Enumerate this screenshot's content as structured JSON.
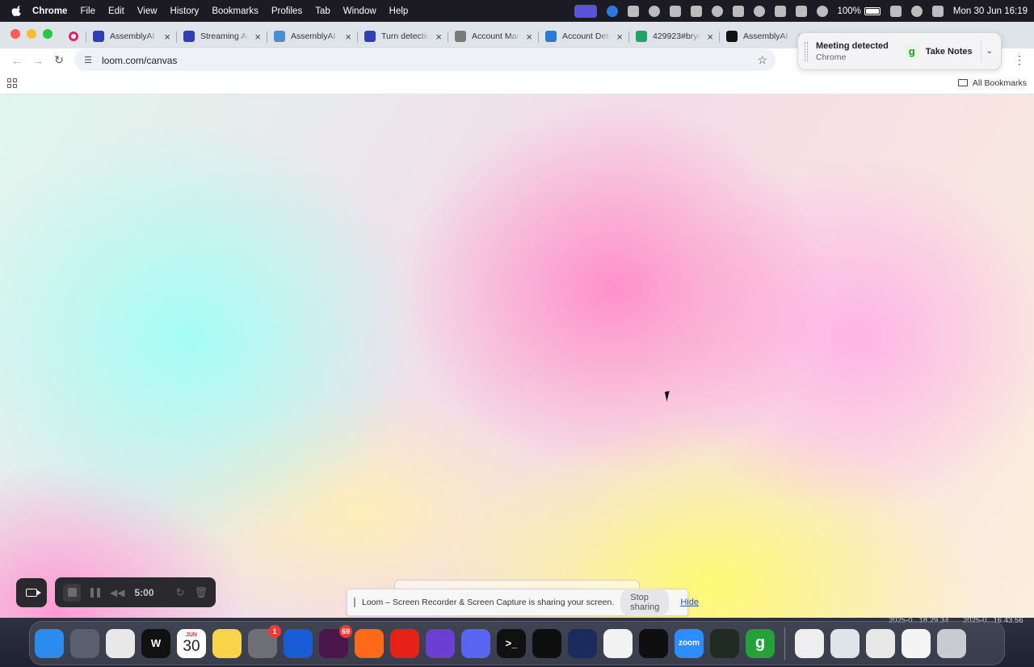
{
  "menubar": {
    "app_name": "Chrome",
    "items": [
      "File",
      "Edit",
      "View",
      "History",
      "Bookmarks",
      "Profiles",
      "Tab",
      "Window",
      "Help"
    ],
    "battery": "100%",
    "battery_level": 1.0,
    "datetime": "Mon 30 Jun  16:19"
  },
  "tabs": [
    {
      "title": "",
      "icon": "recording-icon",
      "color": "#e0245e"
    },
    {
      "title": "AssemblyAI |",
      "icon": "assemblyai-icon",
      "color": "#2f3fb6"
    },
    {
      "title": "Streaming Au",
      "icon": "assemblyai-icon",
      "color": "#2f3fb6"
    },
    {
      "title": "AssemblyAI -",
      "icon": "docs-icon",
      "color": "#4a8fd6"
    },
    {
      "title": "Turn detectio",
      "icon": "assemblyai-icon",
      "color": "#2f3fb6"
    },
    {
      "title": "Account Mana",
      "icon": "account-icon",
      "color": "#7a7a7a"
    },
    {
      "title": "Account Deta",
      "icon": "account-icon",
      "color": "#2a7bd8"
    },
    {
      "title": "429923#brya",
      "icon": "sheet-icon",
      "color": "#21a366"
    },
    {
      "title": "AssemblyAI",
      "icon": "github-icon",
      "color": "#111111"
    }
  ],
  "toolbar": {
    "url": "loom.com/canvas"
  },
  "bookmarks": {
    "all_label": "All Bookmarks"
  },
  "meeting_popup": {
    "title": "Meeting detected",
    "subtitle": "Chrome",
    "button_label": "Take Notes",
    "logo_letter": "g"
  },
  "loom": {
    "timer": "5:00"
  },
  "sharing": {
    "message": "Loom – Screen Recorder & Screen Capture is sharing your screen.",
    "stop_label": "Stop sharing",
    "hide_label": "Hide"
  },
  "desktop_labels": [
    "2025-0...18.29.34",
    "2025-0...16.43.56"
  ],
  "dock": [
    {
      "name": "finder",
      "color": "#2b8cf0"
    },
    {
      "name": "launchpad",
      "color": "#5a5f6e"
    },
    {
      "name": "chrome",
      "color": "#e8e8e8"
    },
    {
      "name": "wunderbucket",
      "color": "#111111",
      "label": "W"
    },
    {
      "name": "calendar",
      "month": "JUN",
      "day": "30"
    },
    {
      "name": "notes",
      "color": "#f9d44a"
    },
    {
      "name": "system-settings",
      "color": "#6d6f75",
      "badge": "1"
    },
    {
      "name": "1password",
      "color": "#1a5bd6"
    },
    {
      "name": "slack",
      "color": "#4a154b",
      "badge": "69"
    },
    {
      "name": "pen-tool",
      "color": "#ff6a1a"
    },
    {
      "name": "youtube-music",
      "color": "#e62117"
    },
    {
      "name": "obsidian",
      "color": "#6b3fd1"
    },
    {
      "name": "discord",
      "color": "#5865f2"
    },
    {
      "name": "terminal",
      "color": "#111111",
      "label": ">_"
    },
    {
      "name": "chatgpt",
      "color": "#0f0f0f"
    },
    {
      "name": "audacity",
      "color": "#1b2b5e"
    },
    {
      "name": "google-drive",
      "color": "#f2f2f2"
    },
    {
      "name": "cube-app",
      "color": "#0f0f0f"
    },
    {
      "name": "zoom",
      "color": "#2d8cff",
      "label": "zoom"
    },
    {
      "name": "activity-monitor",
      "color": "#1e2a22"
    },
    {
      "name": "granola",
      "color": "#21a33a",
      "label": "g"
    },
    {
      "name": "file-doc-1",
      "color": "#eeeeee"
    },
    {
      "name": "file-doc-2",
      "color": "#dfe4ea"
    },
    {
      "name": "file-doc-3",
      "color": "#e8e8e8"
    },
    {
      "name": "file-doc-4",
      "color": "#f4f4f4"
    },
    {
      "name": "trash",
      "color": "#c8cbd0"
    }
  ]
}
